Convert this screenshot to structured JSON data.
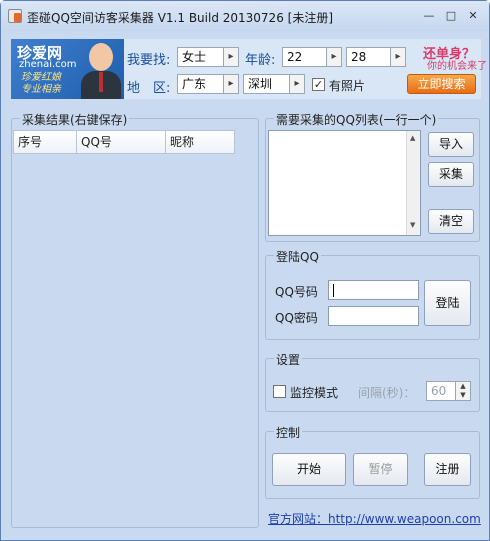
{
  "window": {
    "title": "歪碰QQ空间访客采集器 V1.1 Build 20130726 [未注册]"
  },
  "titlebar": {
    "minimize_icon": "minimize-icon",
    "restore_icon": "restore-icon",
    "close_icon": "close-icon"
  },
  "banner": {
    "logo_title": "珍爱网",
    "logo_url": "zhenai.com",
    "logo_slogan_1": "珍爱红娘",
    "logo_slogan_2": "专业相亲",
    "seek_label": "我要找:",
    "gender_value": "女士",
    "age_label": "年龄:",
    "age_from": "22",
    "age_to": "28",
    "region_label": "地　区:",
    "province_value": "广东",
    "city_value": "深圳",
    "photo_checked": true,
    "photo_label": "有照片",
    "promo_text": "还单身？",
    "promo_sub": "你的机会来了",
    "search_button": "立即搜索"
  },
  "results": {
    "group_title": "采集结果(右键保存)",
    "columns": [
      "序号",
      "QQ号",
      "昵称"
    ],
    "rows": []
  },
  "qq_list": {
    "group_title": "需要采集的QQ列表(一行一个)",
    "import_button": "导入",
    "collect_button": "采集",
    "clear_button": "清空"
  },
  "login": {
    "group_title": "登陆QQ",
    "qq_number_label": "QQ号码",
    "qq_password_label": "QQ密码",
    "qq_number_value": "",
    "qq_password_value": "",
    "login_button": "登陆"
  },
  "settings": {
    "group_title": "设置",
    "monitor_label": "监控模式",
    "monitor_checked": false,
    "interval_label": "间隔(秒)：",
    "interval_value": "60"
  },
  "control": {
    "group_title": "控制",
    "start_button": "开始",
    "pause_button": "暂停",
    "register_button": "注册"
  },
  "footer": {
    "site_link": "官方网站：http://www.weapoon.com"
  }
}
